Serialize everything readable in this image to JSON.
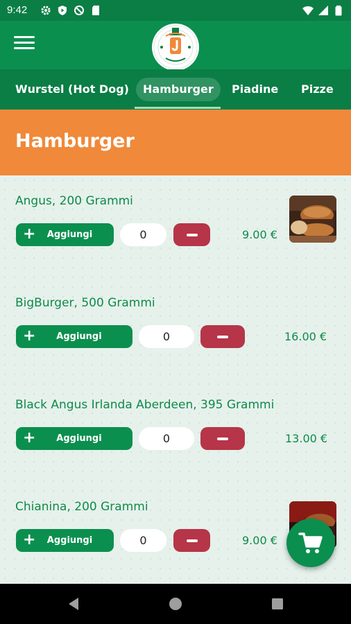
{
  "status_bar": {
    "time": "9:42",
    "left_icons": [
      "gear-icon",
      "shield-play-icon",
      "no-sync-icon",
      "sd-card-icon"
    ],
    "right_icons": [
      "wifi-icon",
      "signal-icon",
      "battery-icon"
    ]
  },
  "app_bar": {
    "menu_icon": "hamburger-menu-icon",
    "logo_icon": "restaurant-logo"
  },
  "tabs": [
    {
      "label": "Wurstel (Hot Dog)",
      "active": false
    },
    {
      "label": "Hamburger",
      "active": true
    },
    {
      "label": "Piadine",
      "active": false
    },
    {
      "label": "Pizze",
      "active": false
    }
  ],
  "section": {
    "title": "Hamburger"
  },
  "products": [
    {
      "name": "Angus, 200 Grammi",
      "add_label": "Aggiungi",
      "quantity": "0",
      "price": "9.00 €",
      "has_image": true
    },
    {
      "name": "BigBurger, 500 Grammi",
      "add_label": "Aggiungi",
      "quantity": "0",
      "price": "16.00 €",
      "has_image": false
    },
    {
      "name": "Black Angus Irlanda Aberdeen, 395 Grammi",
      "add_label": "Aggiungi",
      "quantity": "0",
      "price": "13.00 €",
      "has_image": false
    },
    {
      "name": "Chianina, 200 Grammi",
      "add_label": "Aggiungi",
      "quantity": "0",
      "price": "9.00 €",
      "has_image": true
    }
  ],
  "cart_fab": {
    "icon": "shopping-cart-icon"
  },
  "nav_bar": {
    "icons": [
      "back-icon",
      "home-icon",
      "recents-icon"
    ]
  },
  "colors": {
    "primary_green": "#0a8f4f",
    "dark_green": "#0a7e45",
    "section_orange": "#f0893a",
    "minus_red": "#b63548",
    "text_green": "#0f8a48"
  }
}
